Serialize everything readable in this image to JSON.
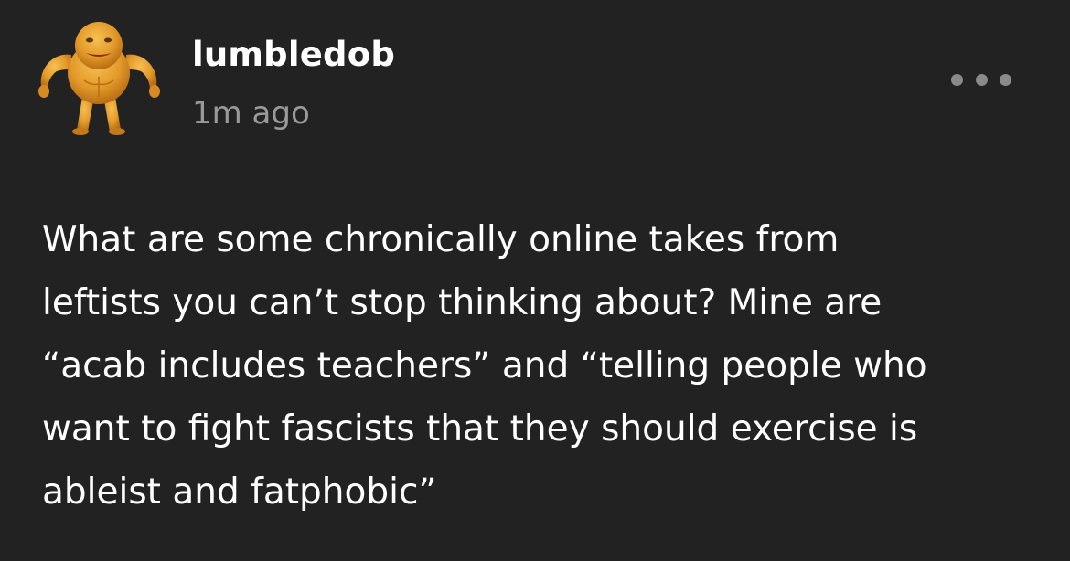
{
  "post": {
    "username": "lumbledob",
    "timestamp": "1m ago",
    "avatar_icon": "muscular-orange-blob-avatar",
    "more_icon": "more-options-icon",
    "body_lines": [
      "What are some chronically online takes from",
      "leftists you can’t stop thinking about? Mine are",
      "“acab includes teachers” and “telling people who",
      "want to fight fascists that they should exercise is",
      "ableist and fatphobic”"
    ]
  },
  "colors": {
    "background": "#222222",
    "text": "#ffffff",
    "muted": "#9a9a9a",
    "avatar": "#e8a030"
  }
}
